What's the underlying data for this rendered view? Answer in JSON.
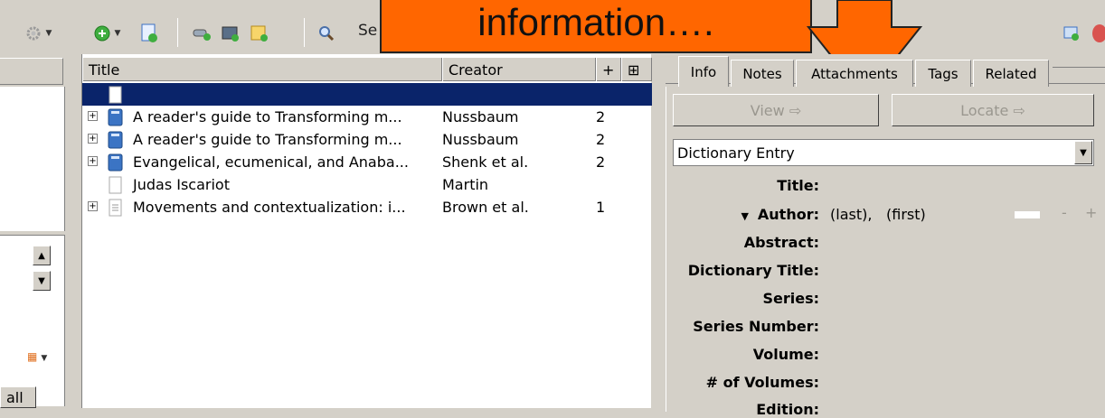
{
  "toolbar": {
    "gear_icon": "gear-icon",
    "new_item_icon": "add-circle-icon",
    "new_note_icon": "new-note-icon",
    "search_label": "Se"
  },
  "callout": {
    "text": "information….",
    "color": "#ff6600"
  },
  "left_pane": {
    "all_label": "all"
  },
  "items": {
    "columns": [
      "Title",
      "Creator",
      "+"
    ],
    "rows": [
      {
        "title": "",
        "creator": "",
        "count": "",
        "expandable": false,
        "selected": true
      },
      {
        "title": "A reader's guide to Transforming m...",
        "creator": "Nussbaum",
        "count": "2",
        "expandable": true,
        "selected": false
      },
      {
        "title": "A reader's guide to Transforming m...",
        "creator": "Nussbaum",
        "count": "2",
        "expandable": true,
        "selected": false
      },
      {
        "title": "Evangelical, ecumenical, and Anaba...",
        "creator": "Shenk et al.",
        "count": "2",
        "expandable": true,
        "selected": false
      },
      {
        "title": "Judas Iscariot",
        "creator": "Martin",
        "count": "",
        "expandable": false,
        "selected": false
      },
      {
        "title": "Movements and contextualization: i...",
        "creator": "Brown et al.",
        "count": "1",
        "expandable": true,
        "selected": false
      }
    ]
  },
  "item_pane": {
    "tabs": [
      "Info",
      "Notes",
      "Attachments",
      "Tags",
      "Related"
    ],
    "active_tab": "Info",
    "view_label": "View ⇨",
    "locate_label": "Locate ⇨",
    "item_type": "Dictionary Entry",
    "fields": {
      "title": "Title:",
      "author": "Author:",
      "author_last": "(last),",
      "author_first": "(first)",
      "abstract": "Abstract:",
      "dictionary_title": "Dictionary Title:",
      "series": "Series:",
      "series_number": "Series Number:",
      "volume": "Volume:",
      "num_volumes": "# of Volumes:",
      "edition": "Edition:"
    },
    "minus": "-",
    "plus": "+"
  },
  "colors": {
    "chrome": "#d4d0c8",
    "selection": "#0a246a",
    "callout": "#ff6600"
  }
}
